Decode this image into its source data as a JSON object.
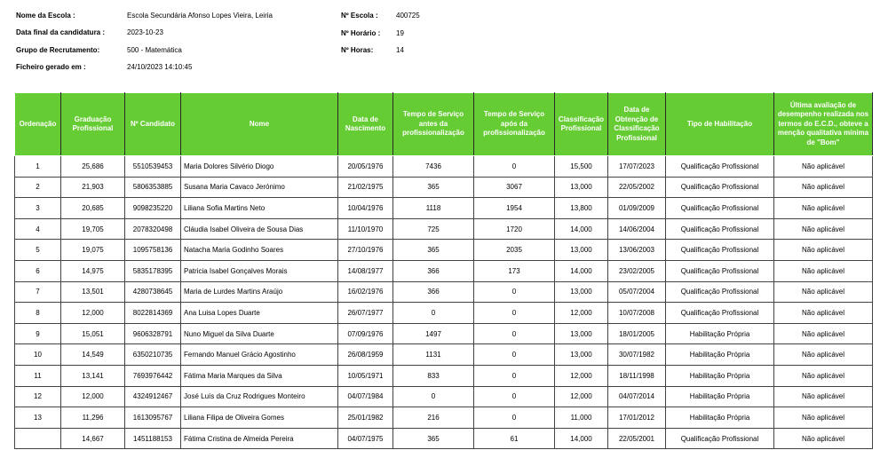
{
  "info": {
    "escola_label": "Nome da Escola :",
    "escola_value": "Escola Secundária Afonso Lopes Vieira, Leiria",
    "data_label": "Data final da candidatura :",
    "data_value": "2023-10-23",
    "grupo_label": "Grupo de Recrutamento:",
    "grupo_value": "500 - Matemática",
    "ficheiro_label": "Ficheiro gerado em :",
    "ficheiro_value": "24/10/2023 14:10:45",
    "num_escola_label": "Nº Escola :",
    "num_escola_value": "400725",
    "num_horario_label": "Nº Horário :",
    "num_horario_value": "19",
    "num_horas_label": "Nº Horas:",
    "num_horas_value": "14"
  },
  "table": {
    "headers": [
      "Ordenação",
      "Graduação Profissional",
      "Nº Candidato",
      "Nome",
      "Data de Nascimento",
      "Tempo de Serviço antes da profissionalização",
      "Tempo de Serviço após da profissionalização",
      "Classificação Profissional",
      "Data de Obtenção de Classificação Profissional",
      "Tipo de Habilitação",
      "Última avaliação de desempenho realizada nos termos do E.C.D., obteve a menção qualitativa mínima de \"Bom\""
    ],
    "rows": [
      [
        "1",
        "25,686",
        "5510539453",
        "Maria Dolores Silvério Diogo",
        "20/05/1976",
        "7436",
        "0",
        "15,500",
        "17/07/2023",
        "Qualificação Profissional",
        "Não aplicável"
      ],
      [
        "2",
        "21,903",
        "5806353885",
        "Susana Maria Cavaco Jerónimo",
        "21/02/1975",
        "365",
        "3067",
        "13,000",
        "22/05/2002",
        "Qualificação Profissional",
        "Não aplicável"
      ],
      [
        "3",
        "20,685",
        "9098235220",
        "Liliana Sofia Martins Neto",
        "10/04/1976",
        "1118",
        "1954",
        "13,800",
        "01/09/2009",
        "Qualificação Profissional",
        "Não aplicável"
      ],
      [
        "4",
        "19,705",
        "2078320498",
        "Cláudia Isabel Oliveira de Sousa Dias",
        "11/10/1970",
        "725",
        "1720",
        "14,000",
        "14/06/2004",
        "Qualificação Profissional",
        "Não aplicável"
      ],
      [
        "5",
        "19,075",
        "1095758136",
        "Natacha Maria Godinho Soares",
        "27/10/1976",
        "365",
        "2035",
        "13,000",
        "13/06/2003",
        "Qualificação Profissional",
        "Não aplicável"
      ],
      [
        "6",
        "14,975",
        "5835178395",
        "Patricia Isabel Gonçalves Morais",
        "14/08/1977",
        "366",
        "173",
        "14,000",
        "23/02/2005",
        "Qualificação Profissional",
        "Não aplicável"
      ],
      [
        "7",
        "13,501",
        "4280738645",
        "Maria de Lurdes Martins Araújo",
        "16/02/1976",
        "366",
        "0",
        "13,000",
        "05/07/2004",
        "Qualificação Profissional",
        "Não aplicável"
      ],
      [
        "8",
        "12,000",
        "8022814369",
        "Ana Luisa Lopes Duarte",
        "26/07/1977",
        "0",
        "0",
        "12,000",
        "10/07/2008",
        "Qualificação Profissional",
        "Não aplicável"
      ],
      [
        "9",
        "15,051",
        "9606328791",
        "Nuno Miguel da Silva Duarte",
        "07/09/1976",
        "1497",
        "0",
        "13,000",
        "18/01/2005",
        "Habilitação Própria",
        "Não aplicável"
      ],
      [
        "10",
        "14,549",
        "6350210735",
        "Fernando Manuel Grácio Agostinho",
        "26/08/1959",
        "1131",
        "0",
        "13,000",
        "30/07/1982",
        "Habilitação Própria",
        "Não aplicável"
      ],
      [
        "11",
        "13,141",
        "7693976442",
        "Fátima Maria Marques da Silva",
        "10/05/1971",
        "833",
        "0",
        "12,000",
        "18/11/1998",
        "Habilitação Própria",
        "Não aplicável"
      ],
      [
        "12",
        "12,000",
        "4324912467",
        "José Luís da Cruz Rodrigues Monteiro",
        "04/07/1984",
        "0",
        "0",
        "12,000",
        "04/07/2014",
        "Habilitação Própria",
        "Não aplicável"
      ],
      [
        "13",
        "11,296",
        "1613095767",
        "Liliana Filipa de Oliveira Gomes",
        "25/01/1982",
        "216",
        "0",
        "11,000",
        "17/01/2012",
        "Habilitação Própria",
        "Não aplicável"
      ],
      [
        "",
        "14,667",
        "1451188153",
        "Fátima Cristina de Almeida Pereira",
        "04/07/1975",
        "365",
        "61",
        "14,000",
        "22/05/2001",
        "Qualificação Profissional",
        "Não aplicável"
      ]
    ]
  }
}
